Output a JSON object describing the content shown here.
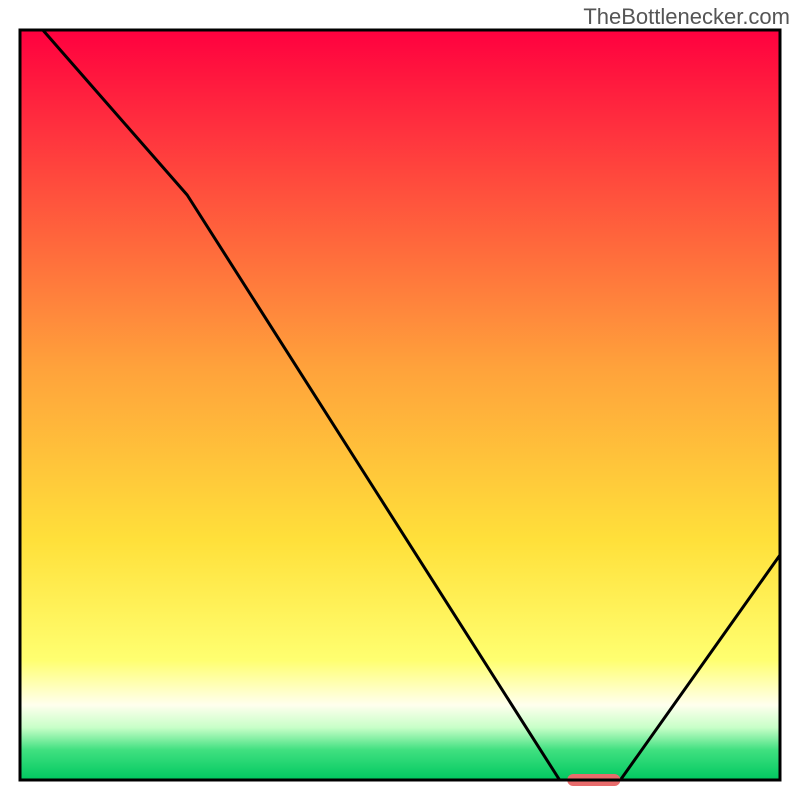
{
  "watermark": "TheBottlenecker.com",
  "chart_data": {
    "type": "line",
    "title": "",
    "xlabel": "",
    "ylabel": "",
    "xlim": [
      0,
      100
    ],
    "ylim": [
      0,
      100
    ],
    "x": [
      0,
      3,
      22,
      71,
      79,
      100
    ],
    "values": [
      100,
      100,
      78,
      0,
      0,
      30
    ],
    "marker_segment": {
      "x0": 72,
      "x1": 79,
      "y": 0
    },
    "background": {
      "stops": [
        {
          "offset": 0.0,
          "color": "#ff003f"
        },
        {
          "offset": 0.2,
          "color": "#ff4a3d"
        },
        {
          "offset": 0.45,
          "color": "#ffa23b"
        },
        {
          "offset": 0.68,
          "color": "#ffe03a"
        },
        {
          "offset": 0.84,
          "color": "#ffff70"
        },
        {
          "offset": 0.9,
          "color": "#ffffee"
        },
        {
          "offset": 0.93,
          "color": "#c8ffc8"
        },
        {
          "offset": 0.96,
          "color": "#40e080"
        },
        {
          "offset": 1.0,
          "color": "#00c860"
        }
      ]
    },
    "marker_color": "#e86b6b",
    "line_color": "#000000",
    "border_color": "#000000"
  }
}
